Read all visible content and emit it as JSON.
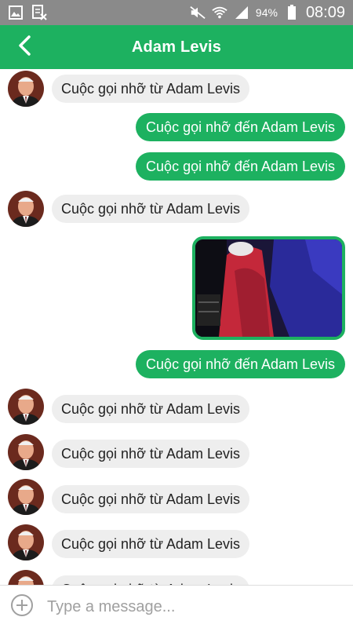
{
  "status_bar": {
    "battery": "94%",
    "time": "08:09"
  },
  "header": {
    "title": "Adam Levis",
    "back_icon": "chevron-left-icon"
  },
  "messages": [
    {
      "direction": "incoming",
      "text": "Cuộc gọi nhỡ từ Adam Levis"
    },
    {
      "direction": "outgoing",
      "text": "Cuộc gọi nhỡ đến Adam Levis"
    },
    {
      "direction": "outgoing",
      "text": "Cuộc gọi nhỡ đến Adam Levis"
    },
    {
      "direction": "incoming",
      "text": "Cuộc gọi nhỡ từ Adam Levis"
    },
    {
      "direction": "outgoing",
      "type": "image"
    },
    {
      "direction": "outgoing",
      "text": "Cuộc gọi nhỡ đến Adam Levis"
    },
    {
      "direction": "incoming",
      "text": "Cuộc gọi nhỡ từ Adam Levis"
    },
    {
      "direction": "incoming",
      "text": "Cuộc gọi nhỡ từ Adam Levis"
    },
    {
      "direction": "incoming",
      "text": "Cuộc gọi nhỡ từ Adam Levis"
    },
    {
      "direction": "incoming",
      "text": "Cuộc gọi nhỡ từ Adam Levis"
    },
    {
      "direction": "incoming",
      "text": "Cuộc gọi nhỡ từ Adam Levis"
    }
  ],
  "composer": {
    "placeholder": "Type a message...",
    "add_icon": "plus-circle-icon"
  },
  "colors": {
    "accent": "#1db160",
    "status_bar": "#8a8a8a",
    "incoming_bubble": "#eeeeee"
  }
}
